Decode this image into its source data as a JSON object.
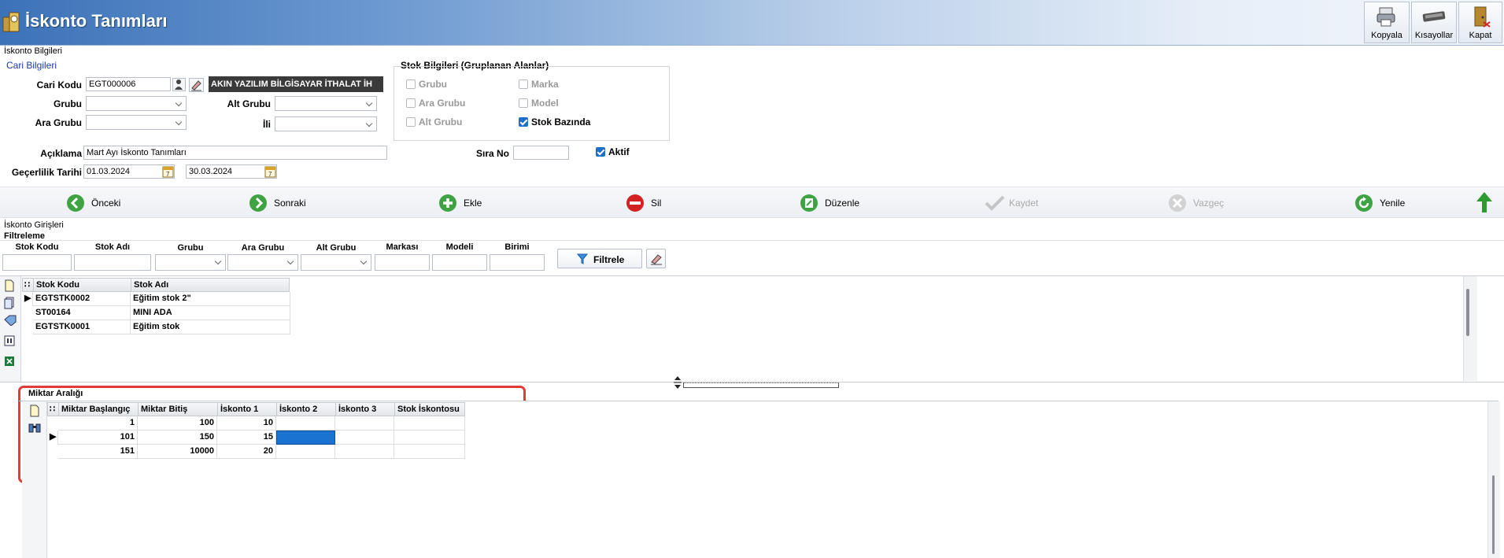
{
  "window": {
    "title": "İskonto Tanımları",
    "toolbar": [
      {
        "label": "Kopyala",
        "icon": "copy-printer-icon"
      },
      {
        "label": "Kısayollar",
        "icon": "keyboard-icon"
      },
      {
        "label": "Kapat",
        "icon": "exit-door-icon"
      }
    ]
  },
  "iskonto_bilgileri": {
    "title": "İskonto Bilgileri",
    "cari_bilgileri": {
      "title": "Cari Bilgileri",
      "cari_kodu_label": "Cari Kodu",
      "cari_kodu_value": "EGT000006",
      "cari_name": "AKIN YAZILIM BİLGİSAYAR İTHALAT İH",
      "grubu_label": "Grubu",
      "alt_grubu_label": "Alt Grubu",
      "ara_grubu_label": "Ara Grubu",
      "ili_label": "İli"
    },
    "stok_bilgileri": {
      "title": "Stok Bilgileri (Gruplanan Alanlar)",
      "checkboxes": [
        {
          "label": "Grubu",
          "checked": false
        },
        {
          "label": "Marka",
          "checked": false
        },
        {
          "label": "Ara Grubu",
          "checked": false
        },
        {
          "label": "Model",
          "checked": false
        },
        {
          "label": "Alt Grubu",
          "checked": false
        },
        {
          "label": "Stok Bazında",
          "checked": true
        }
      ]
    },
    "aciklama_label": "Açıklama",
    "aciklama_value": "Mart Ayı İskonto Tanımları",
    "sira_no_label": "Sıra No",
    "sira_no_value": "",
    "aktif_label": "Aktif",
    "aktif_checked": true,
    "gecerlilik_label": "Geçerlilik Tarihi",
    "date_start": "01.03.2024",
    "date_end": "30.03.2024"
  },
  "navbar": [
    {
      "label": "Önceki",
      "icon": "arrow-left-icon",
      "enabled": true
    },
    {
      "label": "Sonraki",
      "icon": "arrow-right-icon",
      "enabled": true
    },
    {
      "label": "Ekle",
      "icon": "plus-icon",
      "enabled": true
    },
    {
      "label": "Sil",
      "icon": "minus-icon",
      "enabled": true
    },
    {
      "label": "Düzenle",
      "icon": "edit-icon",
      "enabled": true
    },
    {
      "label": "Kaydet",
      "icon": "checkmark-icon",
      "enabled": false
    },
    {
      "label": "Vazgeç",
      "icon": "cancel-icon",
      "enabled": false
    },
    {
      "label": "Yenile",
      "icon": "refresh-icon",
      "enabled": true
    }
  ],
  "iskonto_girisleri": {
    "title": "İskonto Girişleri",
    "filtreleme": {
      "title": "Filtreleme",
      "columns": [
        "Stok Kodu",
        "Stok Adı",
        "Grubu",
        "Ara Grubu",
        "Alt Grubu",
        "Markası",
        "Modeli",
        "Birimi"
      ],
      "filter_button": "Filtrele"
    },
    "stock_grid": {
      "headers": [
        "Stok Kodu",
        "Stok Adı"
      ],
      "rows": [
        {
          "code": "EGTSTK0002",
          "name": "Eğitim stok 2\"",
          "current": true
        },
        {
          "code": "ST00164",
          "name": "MINI ADA",
          "current": false
        },
        {
          "code": "EGTSTK0001",
          "name": "Eğitim stok",
          "current": false
        }
      ]
    }
  },
  "miktar_araligi": {
    "title": "Miktar Aralığı",
    "headers": [
      "Miktar Başlangıç",
      "Miktar Bitiş",
      "İskonto 1",
      "İskonto 2",
      "İskonto 3",
      "Stok İskontosu"
    ],
    "rows": [
      {
        "start": "1",
        "end": "100",
        "isk1": "10",
        "isk2": "",
        "isk3": "",
        "stok": "",
        "current": false
      },
      {
        "start": "101",
        "end": "150",
        "isk1": "15",
        "isk2": "",
        "isk3": "",
        "stok": "",
        "current": true
      },
      {
        "start": "151",
        "end": "10000",
        "isk1": "20",
        "isk2": "",
        "isk3": "",
        "stok": "",
        "current": false
      }
    ]
  },
  "colors": {
    "highlight": "#e03c3c",
    "selected_cell": "#1a73d1",
    "accent": "#1a3aa8"
  }
}
